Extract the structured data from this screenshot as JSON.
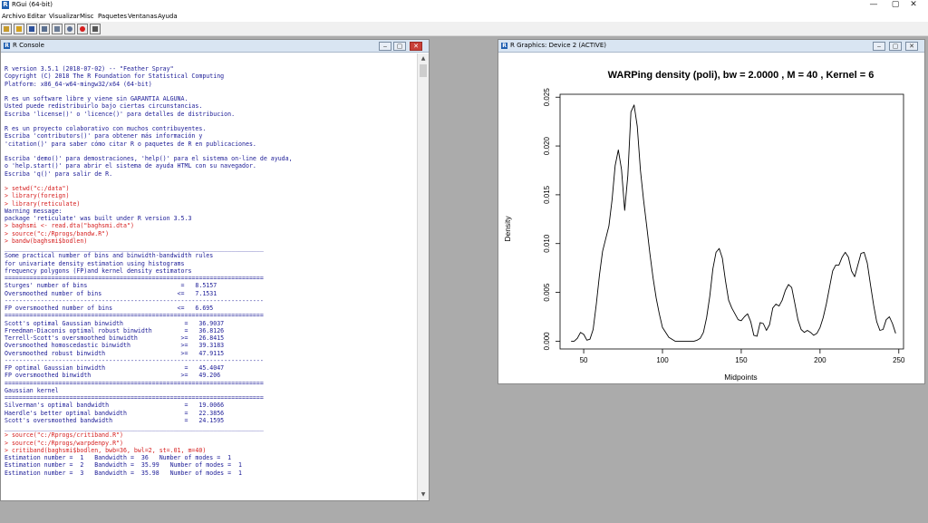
{
  "app": {
    "title": "RGui (64-bit)",
    "logo_letter": "R",
    "window_controls": [
      "—",
      "▢",
      "✕"
    ]
  },
  "menu": [
    "Archivo",
    "Editar",
    "Visualizar",
    "Misc",
    "Paquetes",
    "Ventanas",
    "Ayuda"
  ],
  "toolbar": [
    {
      "icon": "open-script-icon",
      "color": "#c69a2b"
    },
    {
      "icon": "load-workspace-icon",
      "color": "#d4a11f"
    },
    {
      "icon": "save-workspace-icon",
      "color": "#2a4f9c"
    },
    {
      "icon": "copy-icon",
      "color": "#5a6f8f"
    },
    {
      "icon": "paste-icon",
      "color": "#6a7b95"
    },
    {
      "icon": "copy-paste-icon",
      "color": "#5c6f92"
    },
    {
      "icon": "stop-icon",
      "color": "#d71e1e"
    },
    {
      "icon": "print-icon",
      "color": "#555555"
    }
  ],
  "console": {
    "title": "R Console",
    "lines": [
      {
        "t": "R version 3.5.1 (2018-07-02) -- \"Feather Spray\"",
        "k": "out"
      },
      {
        "t": "Copyright (C) 2018 The R Foundation for Statistical Computing",
        "k": "out"
      },
      {
        "t": "Platform: x86_64-w64-mingw32/x64 (64-bit)",
        "k": "out"
      },
      {
        "t": "",
        "k": "out"
      },
      {
        "t": "R es un software libre y viene sin GARANTIA ALGUNA.",
        "k": "out"
      },
      {
        "t": "Usted puede redistribuirlo bajo ciertas circunstancias.",
        "k": "out"
      },
      {
        "t": "Escriba 'license()' o 'licence()' para detalles de distribucion.",
        "k": "out"
      },
      {
        "t": "",
        "k": "out"
      },
      {
        "t": "R es un proyecto colaborativo con muchos contribuyentes.",
        "k": "out"
      },
      {
        "t": "Escriba 'contributors()' para obtener más información y",
        "k": "out"
      },
      {
        "t": "'citation()' para saber cómo citar R o paquetes de R en publicaciones.",
        "k": "out"
      },
      {
        "t": "",
        "k": "out"
      },
      {
        "t": "Escriba 'demo()' para demostraciones, 'help()' para el sistema on-line de ayuda,",
        "k": "out"
      },
      {
        "t": "o 'help.start()' para abrir el sistema de ayuda HTML con su navegador.",
        "k": "out"
      },
      {
        "t": "Escriba 'q()' para salir de R.",
        "k": "out"
      },
      {
        "t": "",
        "k": "out"
      },
      {
        "t": "> setwd(\"c:/data\")",
        "k": "cmd"
      },
      {
        "t": "> library(foreign)",
        "k": "cmd"
      },
      {
        "t": "> library(reticulate)",
        "k": "cmd"
      },
      {
        "t": "Warning message:",
        "k": "err"
      },
      {
        "t": "package 'reticulate' was built under R version 3.5.3",
        "k": "err"
      },
      {
        "t": "> baghsmi <- read.dta(\"baghsmi.dta\")",
        "k": "cmd"
      },
      {
        "t": "> source(\"c:/Rprogs/bandw.R\")",
        "k": "cmd"
      },
      {
        "t": "> bandw(baghsmi$bodlen)",
        "k": "cmd"
      },
      {
        "t": "________________________________________________________________________",
        "k": "out"
      },
      {
        "t": "Some practical number of bins and binwidth-bandwidth rules",
        "k": "out"
      },
      {
        "t": "for univariate density estimation using histograms",
        "k": "out"
      },
      {
        "t": "frequency polygons (FP)and kernel density estimators",
        "k": "out"
      },
      {
        "t": "========================================================================",
        "k": "out"
      },
      {
        "t": "Sturges' number of bins                          =   8.5157",
        "k": "out"
      },
      {
        "t": "Oversmoothed number of bins                     <=   7.1531",
        "k": "out"
      },
      {
        "t": "------------------------------------------------------------------------",
        "k": "out"
      },
      {
        "t": "FP oversmoothed number of bins                  <=   6.695",
        "k": "out"
      },
      {
        "t": "========================================================================",
        "k": "out"
      },
      {
        "t": "Scott's optimal Gaussian binwidth                 =   36.9037",
        "k": "out"
      },
      {
        "t": "Freedman-Diaconis optimal robust binwidth         =   36.8126",
        "k": "out"
      },
      {
        "t": "Terrell-Scott's oversmoothed binwidth            >=   26.8415",
        "k": "out"
      },
      {
        "t": "Oversmoothed homoscedastic binwidth              >=   39.3183",
        "k": "out"
      },
      {
        "t": "Oversmoothed robust binwidth                     >=   47.9115",
        "k": "out"
      },
      {
        "t": "------------------------------------------------------------------------",
        "k": "out"
      },
      {
        "t": "FP optimal Gaussian binwidth                      =   45.4047",
        "k": "out"
      },
      {
        "t": "FP oversmoothed binwidth                         >=   49.206",
        "k": "out"
      },
      {
        "t": "========================================================================",
        "k": "out"
      },
      {
        "t": "Gaussian kernel",
        "k": "out"
      },
      {
        "t": "========================================================================",
        "k": "out"
      },
      {
        "t": "Silverman's optimal bandwidth                     =   19.0066",
        "k": "out"
      },
      {
        "t": "Haerdle's better optimal bandwidth                =   22.3856",
        "k": "out"
      },
      {
        "t": "Scott's oversmoothed bandwidth                    =   24.1595",
        "k": "out"
      },
      {
        "t": "________________________________________________________________________",
        "k": "out"
      },
      {
        "t": "> source(\"c:/Rprogs/critiband.R\")",
        "k": "cmd"
      },
      {
        "t": "> source(\"c:/Rprogs/warpdenpy.R\")",
        "k": "cmd"
      },
      {
        "t": "> critiband(baghsmi$bodlen, bwb=36, bwl=2, st=.01, m=40)",
        "k": "cmd"
      },
      {
        "t": "Estimation number =  1   Bandwidth =  36   Number of modes =  1",
        "k": "out"
      },
      {
        "t": "Estimation number =  2   Bandwidth =  35.99   Number of modes =  1",
        "k": "out"
      },
      {
        "t": "Estimation number =  3   Bandwidth =  35.98   Number of modes =  1",
        "k": "out"
      }
    ]
  },
  "graphics": {
    "title": "R Graphics: Device 2 (ACTIVE)"
  },
  "chart_data": {
    "type": "line",
    "title": "WARPing density (poli), bw = 2.0000 , M =  40 , Kernel =  6",
    "xlabel": "Midpoints",
    "ylabel": "Density",
    "xlim": [
      35,
      253
    ],
    "ylim": [
      -0.0008,
      0.0253
    ],
    "x_ticks": [
      50,
      100,
      150,
      200,
      250
    ],
    "y_ticks": [
      0.0,
      0.005,
      0.01,
      0.015,
      0.02,
      0.025
    ],
    "y_tick_labels": [
      "0.000",
      "0.005",
      "0.010",
      "0.015",
      "0.020",
      "0.025"
    ],
    "grid": false,
    "series": [
      {
        "x": [
          42,
          44,
          46,
          48,
          50,
          52,
          54,
          56,
          58,
          60,
          62,
          64,
          66,
          68,
          70,
          72,
          74,
          76,
          78,
          80,
          82,
          84,
          86,
          88,
          90,
          92,
          94,
          96,
          98,
          100,
          104,
          108,
          112,
          116,
          120,
          122,
          124,
          126,
          128,
          130,
          132,
          134,
          136,
          138,
          140,
          142,
          144,
          146,
          148,
          150,
          152,
          154,
          156,
          158,
          160,
          162,
          164,
          166,
          168,
          170,
          172,
          174,
          176,
          178,
          180,
          182,
          184,
          186,
          188,
          190,
          192,
          194,
          196,
          198,
          200,
          202,
          204,
          206,
          208,
          210,
          212,
          214,
          216,
          218,
          220,
          222,
          224,
          226,
          228,
          230,
          232,
          234,
          236,
          238,
          240,
          242,
          244,
          246,
          248
        ],
        "y": [
          0.0,
          0.0,
          0.0003,
          0.0009,
          0.0007,
          0.0001,
          0.0002,
          0.0012,
          0.0038,
          0.0068,
          0.0092,
          0.0105,
          0.0118,
          0.0145,
          0.018,
          0.0196,
          0.0176,
          0.0134,
          0.017,
          0.0235,
          0.0242,
          0.022,
          0.0175,
          0.0145,
          0.0118,
          0.009,
          0.0065,
          0.0044,
          0.0028,
          0.0014,
          0.0004,
          0.0,
          0.0,
          0.0,
          0.0,
          0.0001,
          0.0003,
          0.0009,
          0.0024,
          0.0046,
          0.0074,
          0.0091,
          0.0095,
          0.0085,
          0.0062,
          0.0042,
          0.0034,
          0.0028,
          0.0022,
          0.0021,
          0.0025,
          0.0028,
          0.002,
          0.0006,
          0.0005,
          0.0019,
          0.0018,
          0.0011,
          0.0017,
          0.0034,
          0.0038,
          0.0036,
          0.0042,
          0.0052,
          0.0058,
          0.0055,
          0.0039,
          0.0022,
          0.0012,
          0.0009,
          0.0011,
          0.0009,
          0.0006,
          0.0008,
          0.0014,
          0.0024,
          0.0038,
          0.0055,
          0.0072,
          0.0078,
          0.0078,
          0.0086,
          0.0091,
          0.0086,
          0.0072,
          0.0066,
          0.0078,
          0.009,
          0.0091,
          0.008,
          0.0058,
          0.0037,
          0.002,
          0.0011,
          0.0012,
          0.0022,
          0.0025,
          0.0018,
          0.0008
        ]
      }
    ]
  }
}
